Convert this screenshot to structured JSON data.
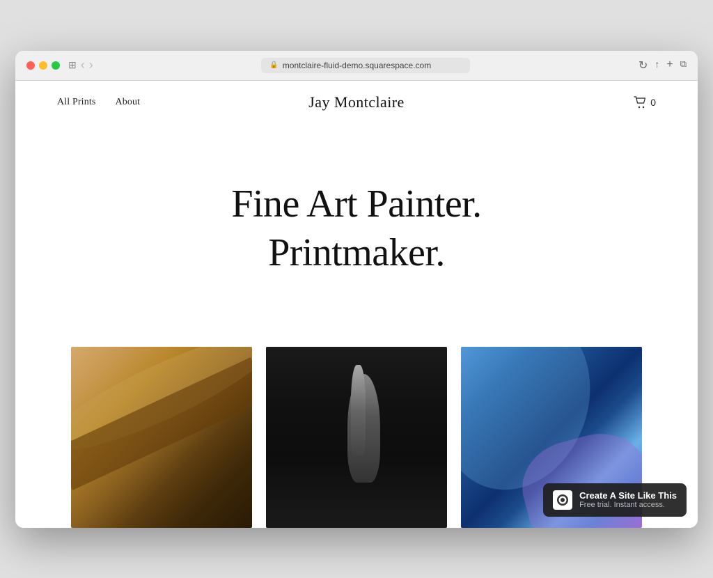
{
  "browser": {
    "url": "montclaire-fluid-demo.squarespace.com",
    "back_icon": "‹",
    "forward_icon": "›",
    "window_icon": "⊞",
    "reload_icon": "↻",
    "share_icon": "↑",
    "add_tab_icon": "+",
    "duplicate_icon": "⧉"
  },
  "nav": {
    "all_prints_label": "All Prints",
    "about_label": "About",
    "site_title": "Jay Montclaire",
    "cart_count": "0"
  },
  "hero": {
    "line1": "Fine Art Painter.",
    "line2": "Printmaker."
  },
  "gallery": {
    "images": [
      {
        "alt": "Warm abstract painting",
        "type": "warm"
      },
      {
        "alt": "Dark abstract brushwork painting",
        "type": "dark"
      },
      {
        "alt": "Blue fluid abstract painting",
        "type": "blue"
      }
    ]
  },
  "badge": {
    "title": "Create A Site Like This",
    "subtitle": "Free trial. Instant access."
  }
}
